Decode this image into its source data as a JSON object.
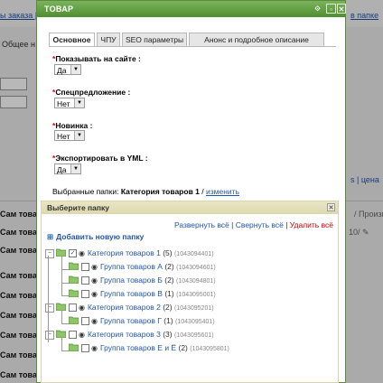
{
  "background": {
    "link_left": "ы заказа |",
    "link_right": "в папке",
    "general": "Общее н",
    "right_link": "s | цена",
    "right_text": "/ Произв",
    "right_text2": "10/ ✎",
    "row_label": "Сам това"
  },
  "dialog": {
    "title": "ТОВАР",
    "tabs": [
      "Основное",
      "ЧПУ",
      "SEO параметры",
      "Анонс и подробное описание"
    ],
    "fields": [
      {
        "label": "Показывать на сайте :",
        "value": "Да"
      },
      {
        "label": "Спецпредложение :",
        "value": "Нет"
      },
      {
        "label": "Новинка :",
        "value": "Нет"
      },
      {
        "label": "Экспортировать в YML :",
        "value": "Да"
      }
    ],
    "required_mark": "*",
    "selected_folders_label": "Выбранные папки:",
    "selected_folder_name": "Категория товаров 1",
    "change_link": "изменить",
    "change_prefix": "/"
  },
  "picker": {
    "title": "Выберите папку",
    "expand_all": "Развернуть всё",
    "collapse_all": "Свернуть всё",
    "delete_all": "Удалить всё",
    "separator": "|",
    "add_folder": "Добавить новую папку",
    "tree": [
      {
        "name": "Категория товаров 1",
        "count": "(5)",
        "id": "(1043094401)",
        "level": 0,
        "checked": true
      },
      {
        "name": "Группа товаров А",
        "count": "(2)",
        "id": "(1043094601)",
        "level": 1,
        "checked": false
      },
      {
        "name": "Группа товаров Б",
        "count": "(2)",
        "id": "(1043094801)",
        "level": 1,
        "checked": false
      },
      {
        "name": "Группа товаров В",
        "count": "(1)",
        "id": "(1043095001)",
        "level": 1,
        "checked": false
      },
      {
        "name": "Категория товаров 2",
        "count": "(2)",
        "id": "(1043095201)",
        "level": 0,
        "checked": false
      },
      {
        "name": "Группа товаров Г",
        "count": "(1)",
        "id": "(1043095401)",
        "level": 1,
        "checked": false
      },
      {
        "name": "Категория товаров 3",
        "count": "(3)",
        "id": "(1043095601)",
        "level": 0,
        "checked": false
      },
      {
        "name": "Группа товаров Е и Ё",
        "count": "(2)",
        "id": "(1043095801)",
        "level": 1,
        "checked": false
      }
    ]
  },
  "colors": {
    "title_bar": "#5b9a3a",
    "link": "#2255aa",
    "required": "#dd0000",
    "picker_bar": "#e3dfba"
  }
}
